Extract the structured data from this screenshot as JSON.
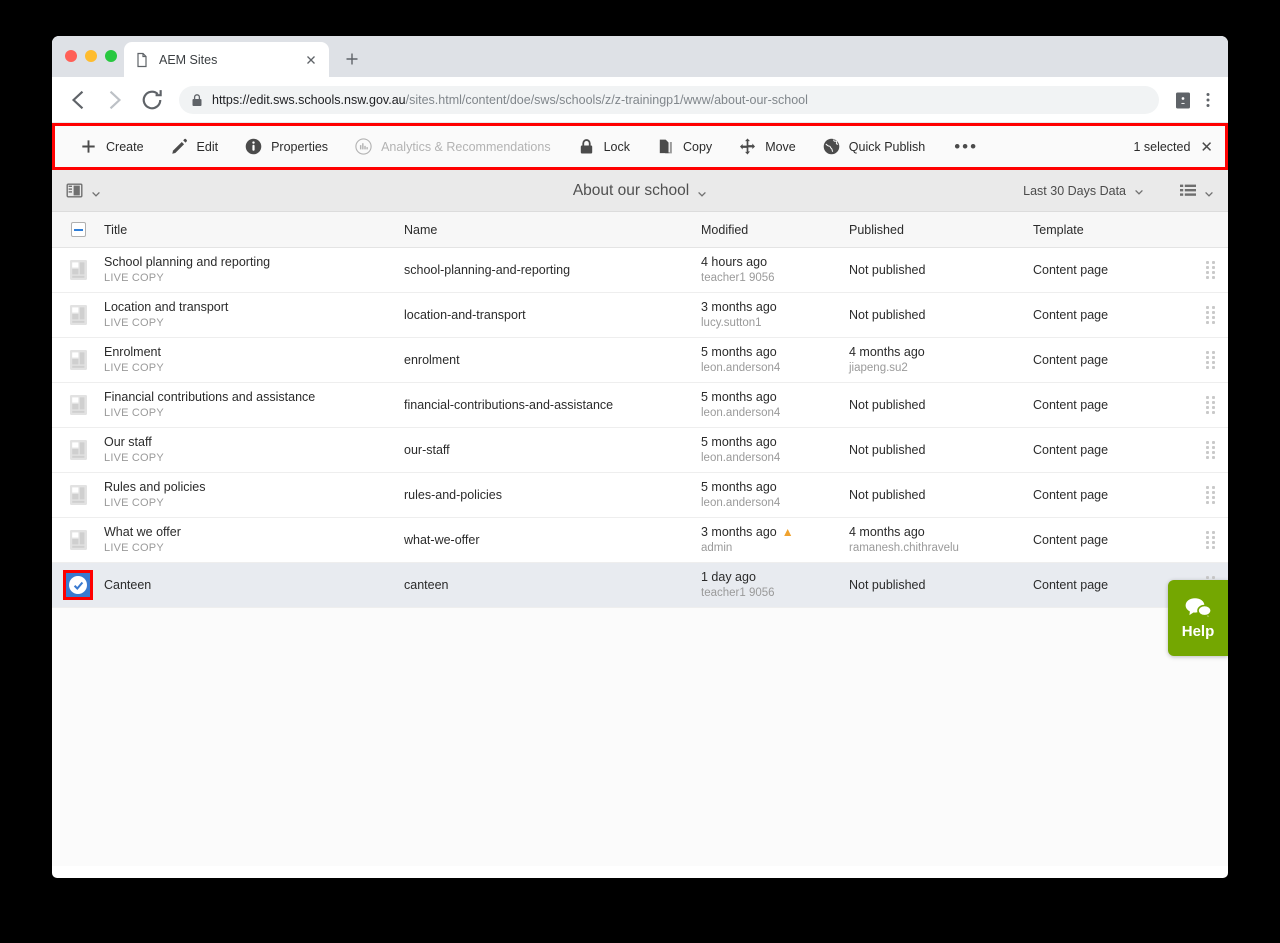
{
  "browser": {
    "tab_title": "AEM Sites",
    "tab_favicon": "page-icon",
    "new_tab_label": "+",
    "back_icon": "back-arrow-icon",
    "forward_icon": "forward-arrow-icon",
    "reload_icon": "reload-icon",
    "lock_icon": "lock-icon",
    "url_secure": "https://edit.sws.schools.nsw.gov.au",
    "url_path": "/sites.html/content/doe/sws/schools/z/z-trainingp1/www/about-our-school",
    "profile_icon": "profile-card-icon",
    "menu_icon": "kebab-menu-icon"
  },
  "toolbar": {
    "actions": [
      {
        "label": "Create",
        "icon": "plus-icon",
        "muted": false
      },
      {
        "label": "Edit",
        "icon": "pencil-icon",
        "muted": false
      },
      {
        "label": "Properties",
        "icon": "info-icon",
        "muted": false
      },
      {
        "label": "Analytics & Recommendations",
        "icon": "analytics-icon",
        "muted": true
      },
      {
        "label": "Lock",
        "icon": "lock-closed-icon",
        "muted": false
      },
      {
        "label": "Copy",
        "icon": "copy-icon",
        "muted": false
      },
      {
        "label": "Move",
        "icon": "move-icon",
        "muted": false
      },
      {
        "label": "Quick Publish",
        "icon": "globe-icon",
        "muted": false
      }
    ],
    "more_label": "•••",
    "selected_label": "1 selected",
    "close_label": "✕"
  },
  "titlebar": {
    "rail_icon": "rail-toggle-icon",
    "rail_chevron": "chevron-down-icon",
    "title": "About our school",
    "title_chevron": "chevron-down-icon",
    "data_range": "Last 30 Days Data",
    "data_range_chevron": "chevron-down-icon",
    "view_icon": "list-view-icon",
    "view_chevron": "chevron-down-icon"
  },
  "table": {
    "headers": {
      "title": "Title",
      "name": "Name",
      "modified": "Modified",
      "published": "Published",
      "template": "Template"
    },
    "select_all_state": "indeterminate",
    "rows": [
      {
        "title": "School planning and reporting",
        "subtitle": "LIVE COPY",
        "name": "school-planning-and-reporting",
        "modified": "4 hours ago",
        "modified_by": "teacher1 9056",
        "modified_warning": false,
        "published": "Not published",
        "published_by": "",
        "template": "Content page",
        "selected": false
      },
      {
        "title": "Location and transport",
        "subtitle": "LIVE COPY",
        "name": "location-and-transport",
        "modified": "3 months ago",
        "modified_by": "lucy.sutton1",
        "modified_warning": false,
        "published": "Not published",
        "published_by": "",
        "template": "Content page",
        "selected": false
      },
      {
        "title": "Enrolment",
        "subtitle": "LIVE COPY",
        "name": "enrolment",
        "modified": "5 months ago",
        "modified_by": "leon.anderson4",
        "modified_warning": false,
        "published": "4 months ago",
        "published_by": "jiapeng.su2",
        "template": "Content page",
        "selected": false
      },
      {
        "title": "Financial contributions and assistance",
        "subtitle": "LIVE COPY",
        "name": "financial-contributions-and-assistance",
        "modified": "5 months ago",
        "modified_by": "leon.anderson4",
        "modified_warning": false,
        "published": "Not published",
        "published_by": "",
        "template": "Content page",
        "selected": false
      },
      {
        "title": "Our staff",
        "subtitle": "LIVE COPY",
        "name": "our-staff",
        "modified": "5 months ago",
        "modified_by": "leon.anderson4",
        "modified_warning": false,
        "published": "Not published",
        "published_by": "",
        "template": "Content page",
        "selected": false
      },
      {
        "title": "Rules and policies",
        "subtitle": "LIVE COPY",
        "name": "rules-and-policies",
        "modified": "5 months ago",
        "modified_by": "leon.anderson4",
        "modified_warning": false,
        "published": "Not published",
        "published_by": "",
        "template": "Content page",
        "selected": false
      },
      {
        "title": "What we offer",
        "subtitle": "LIVE COPY",
        "name": "what-we-offer",
        "modified": "3 months ago",
        "modified_by": "admin",
        "modified_warning": true,
        "published": "4 months ago",
        "published_by": "ramanesh.chithravelu",
        "template": "Content page",
        "selected": false
      },
      {
        "title": "Canteen",
        "subtitle": "",
        "name": "canteen",
        "modified": "1 day ago",
        "modified_by": "teacher1 9056",
        "modified_warning": false,
        "published": "Not published",
        "published_by": "",
        "template": "Content page",
        "selected": true
      }
    ]
  },
  "help_widget": {
    "label": "Help",
    "icon": "chat-bubbles-icon"
  },
  "colors": {
    "highlight": "#ff0000",
    "selection_blue": "#3a7ad0",
    "help_green": "#74a701",
    "warning_amber": "#f0a22e"
  }
}
